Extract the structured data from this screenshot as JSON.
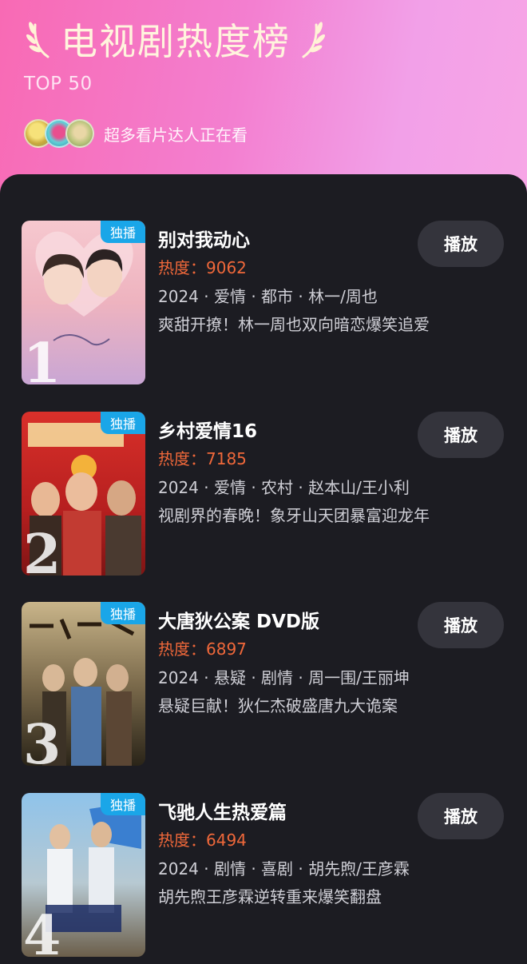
{
  "header": {
    "title": "电视剧热度榜",
    "subtitle": "TOP 50",
    "viewers_text": "超多看片达人正在看"
  },
  "colors": {
    "header_gradient_start": "#f86ab4",
    "header_gradient_end": "#f7a6e6",
    "panel_bg": "#1c1c22",
    "heat_color": "#f0683a",
    "badge_color": "#1aa6e8",
    "play_button_bg": "#34343c"
  },
  "items": [
    {
      "rank": "1",
      "badge": "独播",
      "title": "别对我动心",
      "heat": "热度：9062",
      "meta": "2024 · 爱情 · 都市 · 林一/周也",
      "desc": "爽甜开撩！林一周也双向暗恋爆笑追爱",
      "play_label": "播放"
    },
    {
      "rank": "2",
      "badge": "独播",
      "title": "乡村爱情16",
      "heat": "热度：7185",
      "meta": "2024 · 爱情 · 农村 · 赵本山/王小利",
      "desc": "视剧界的春晚！象牙山天团暴富迎龙年",
      "play_label": "播放"
    },
    {
      "rank": "3",
      "badge": "独播",
      "title": "大唐狄公案 DVD版",
      "heat": "热度：6897",
      "meta": "2024 · 悬疑 · 剧情 · 周一围/王丽坤",
      "desc": "悬疑巨献！狄仁杰破盛唐九大诡案",
      "play_label": "播放"
    },
    {
      "rank": "4",
      "badge": "独播",
      "title": "飞驰人生热爱篇",
      "heat": "热度：6494",
      "meta": "2024 · 剧情 · 喜剧 · 胡先煦/王彦霖",
      "desc": "胡先煦王彦霖逆转重来爆笑翻盘",
      "play_label": "播放"
    }
  ]
}
